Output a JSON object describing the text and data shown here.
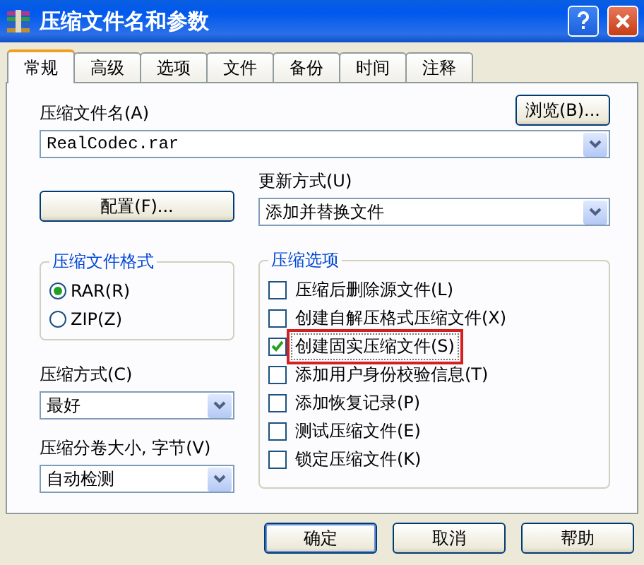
{
  "window": {
    "title": "压缩文件名和参数"
  },
  "tabs": [
    {
      "label": "常规",
      "selected": true
    },
    {
      "label": "高级",
      "selected": false
    },
    {
      "label": "选项",
      "selected": false
    },
    {
      "label": "文件",
      "selected": false
    },
    {
      "label": "备份",
      "selected": false
    },
    {
      "label": "时间",
      "selected": false
    },
    {
      "label": "注释",
      "selected": false
    }
  ],
  "archive_name": {
    "label": "压缩文件名(A)",
    "value": "RealCodec.rar",
    "browse_button": "浏览(B)..."
  },
  "profiles_button": "配置(F)...",
  "update_mode": {
    "label": "更新方式(U)",
    "value": "添加并替换文件"
  },
  "archive_format": {
    "title": "压缩文件格式",
    "options": [
      {
        "label": "RAR(R)",
        "selected": true
      },
      {
        "label": "ZIP(Z)",
        "selected": false
      }
    ]
  },
  "compression_method": {
    "label": "压缩方式(C)",
    "value": "最好"
  },
  "volume_size": {
    "label": "压缩分卷大小, 字节(V)",
    "value": "自动检测"
  },
  "archive_options": {
    "title": "压缩选项",
    "items": [
      {
        "label": "压缩后删除源文件(L)",
        "checked": false,
        "highlighted": false
      },
      {
        "label": "创建自解压格式压缩文件(X)",
        "checked": false,
        "highlighted": false
      },
      {
        "label": "创建固实压缩文件(S)",
        "checked": true,
        "highlighted": true
      },
      {
        "label": "添加用户身份校验信息(T)",
        "checked": false,
        "highlighted": false
      },
      {
        "label": "添加恢复记录(P)",
        "checked": false,
        "highlighted": false
      },
      {
        "label": "测试压缩文件(E)",
        "checked": false,
        "highlighted": false
      },
      {
        "label": "锁定压缩文件(K)",
        "checked": false,
        "highlighted": false
      }
    ]
  },
  "buttons": [
    "确定",
    "取消",
    "帮助"
  ]
}
